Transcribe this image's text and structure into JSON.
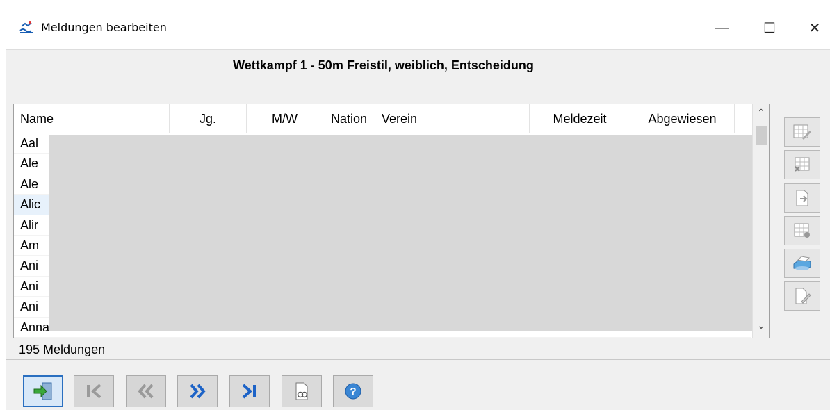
{
  "window": {
    "title": "Meldungen bearbeiten",
    "minimize": "—",
    "maximize": "☐",
    "close": "✕"
  },
  "header": {
    "title": "Wettkampf 1 - 50m Freistil, weiblich, Entscheidung"
  },
  "table": {
    "columns": [
      "Name",
      "Jg.",
      "M/W",
      "Nation",
      "Verein",
      "Meldezeit",
      "Abgewiesen"
    ],
    "rows": [
      {
        "name": "Aal"
      },
      {
        "name": "Ale"
      },
      {
        "name": "Ale"
      },
      {
        "name": "Alic",
        "selected": true
      },
      {
        "name": "Alir"
      },
      {
        "name": "Am"
      },
      {
        "name": "Ani"
      },
      {
        "name": "Ani"
      },
      {
        "name": "Ani"
      },
      {
        "name": "Anna Romann"
      }
    ]
  },
  "status": {
    "count": "195 Meldungen"
  },
  "side_tools": [
    "edit-grid-icon",
    "delete-grid-icon",
    "export-doc-icon",
    "grid-refresh-icon",
    "print-icon",
    "document-edit-icon"
  ],
  "toolbar": [
    "exit-icon",
    "first-icon",
    "previous-icon",
    "next-icon",
    "last-icon",
    "preview-icon",
    "help-icon"
  ],
  "colors": {
    "accent": "#2a6fc0",
    "selected_row": "#e7f1fb",
    "mask": "#d8d8d8"
  }
}
